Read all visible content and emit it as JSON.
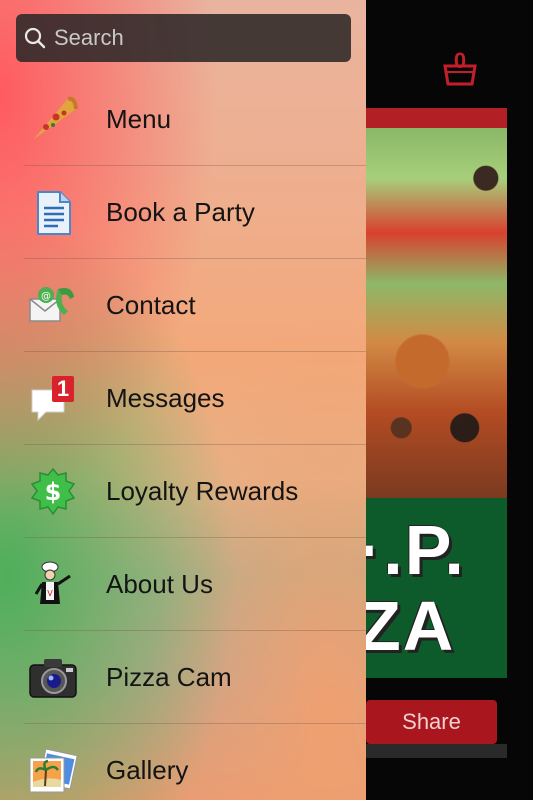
{
  "search": {
    "placeholder": "Search"
  },
  "cart": {
    "count": "0"
  },
  "background": {
    "brand_lines": [
      "·.P.",
      "ZA"
    ],
    "share_label": "Share"
  },
  "menu": {
    "items": [
      {
        "label": "Menu",
        "icon": "pizza-slice-icon"
      },
      {
        "label": "Book a Party",
        "icon": "document-icon"
      },
      {
        "label": "Contact",
        "icon": "phone-envelope-icon"
      },
      {
        "label": "Messages",
        "icon": "messages-icon",
        "badge": "1"
      },
      {
        "label": "Loyalty Rewards",
        "icon": "dollar-badge-icon"
      },
      {
        "label": "About Us",
        "icon": "chef-icon"
      },
      {
        "label": "Pizza Cam",
        "icon": "camera-icon"
      },
      {
        "label": "Gallery",
        "icon": "gallery-icon"
      }
    ]
  },
  "colors": {
    "accent_red": "#c41e2a",
    "brand_green": "#0d5a2b"
  }
}
